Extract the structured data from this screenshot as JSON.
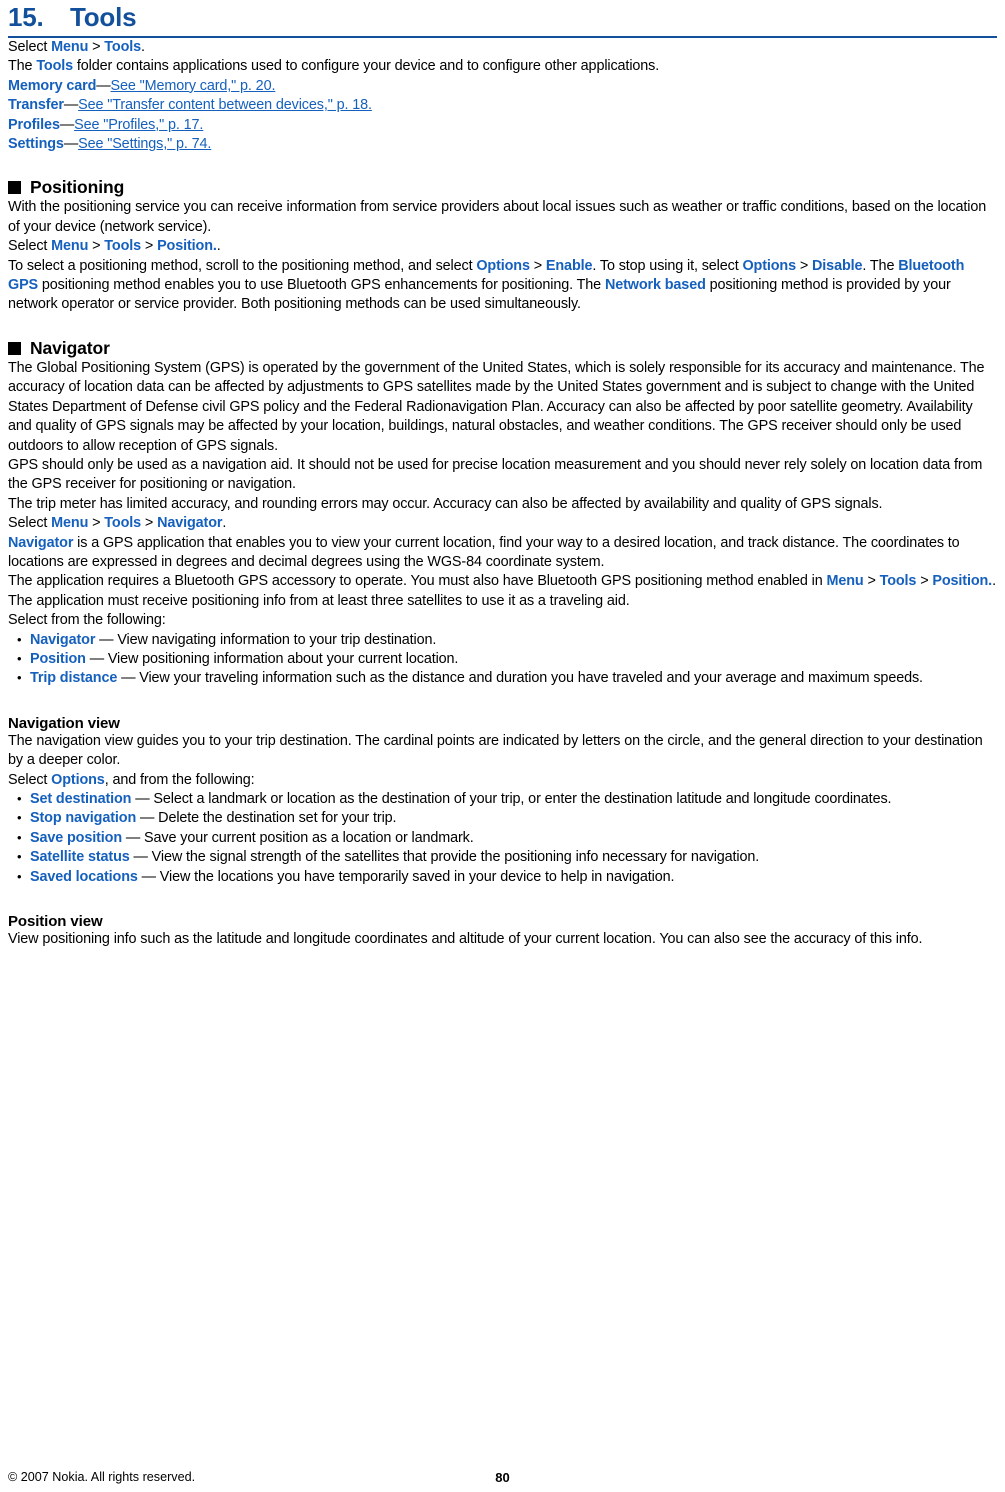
{
  "chapter": {
    "number": "15.",
    "title": "Tools"
  },
  "intro": {
    "select_prefix": "Select ",
    "select_menu": "Menu",
    "sep": " > ",
    "select_tools": "Tools",
    "select_suffix": ".",
    "folder_pre": "The ",
    "folder_tools": "Tools",
    "folder_post": " folder contains applications used to configure your device and to configure other applications.",
    "links": [
      {
        "term": "Memory card",
        "dash": "—",
        "link": "See \"Memory card,\" p. 20."
      },
      {
        "term": "Transfer",
        "dash": "—",
        "link": "See \"Transfer content between devices,\" p. 18."
      },
      {
        "term": "Profiles",
        "dash": "—",
        "link": "See \"Profiles,\" p. 17."
      },
      {
        "term": "Settings",
        "dash": "—",
        "link": "See \"Settings,\" p. 74."
      }
    ]
  },
  "positioning": {
    "heading": "Positioning",
    "p1": "With the positioning service you can receive information from service providers about local issues such as weather or traffic conditions, based on the location of your device (network service).",
    "p2_prefix": "Select ",
    "p2_menu": "Menu",
    "p2_tools": "Tools",
    "p2_position": "Position.",
    "p2_suffix": ".",
    "p3_a": "To select a positioning method, scroll to the positioning method, and select ",
    "p3_options1": "Options",
    "p3_enable": "Enable",
    "p3_b": ". To stop using it, select ",
    "p3_options2": "Options",
    "p3_disable": "Disable",
    "p3_c": ". The ",
    "p3_bt": "Bluetooth GPS",
    "p3_d": " positioning method enables you to use Bluetooth GPS enhancements for positioning. The ",
    "p3_network": "Network based",
    "p3_e": " positioning method is provided by your network operator or service provider. Both positioning methods can be used simultaneously."
  },
  "navigator": {
    "heading": "Navigator",
    "p1": "The Global Positioning System (GPS) is operated by the government of the United States, which is solely responsible for its accuracy and maintenance. The accuracy of location data can be affected by adjustments to GPS satellites made by the United States government and is subject to change with the United States Department of Defense civil GPS policy and the Federal Radionavigation Plan. Accuracy can also be affected by poor satellite geometry. Availability and quality of GPS signals may be affected by your location, buildings, natural obstacles, and weather conditions. The GPS receiver should only be used outdoors to allow reception of GPS signals.",
    "p2": "GPS should only be used as a navigation aid. It should not be used for precise location measurement and you should never rely solely on location data from the GPS receiver for positioning or navigation.",
    "p3": "The trip meter has limited accuracy, and rounding errors may occur. Accuracy can also be affected by availability and quality of GPS signals.",
    "p4_prefix": "Select ",
    "p4_menu": "Menu",
    "p4_tools": "Tools",
    "p4_navigator": "Navigator",
    "p4_suffix": ".",
    "p5_term": "Navigator",
    "p5_text": " is a GPS application that enables you to view your current location, find your way to a desired location, and track distance. The coordinates to locations are expressed in degrees and decimal degrees using the WGS-84 coordinate system.",
    "p6_a": "The application requires a Bluetooth GPS accessory to operate. You must also have Bluetooth GPS positioning method enabled in ",
    "p6_menu": "Menu",
    "p6_tools": "Tools",
    "p6_position": "Position.",
    "p6_suffix": ".",
    "p7": "The application must receive positioning info from at least three satellites to use it as a traveling aid.",
    "p8": "Select from the following:",
    "bullets": [
      {
        "term": "Navigator",
        "desc": " — View navigating information to your trip destination."
      },
      {
        "term": "Position",
        "desc": " — View positioning information about your current location."
      },
      {
        "term": "Trip distance",
        "desc": " — View your traveling information such as the distance and duration you have traveled and your average and maximum speeds."
      }
    ]
  },
  "navigation_view": {
    "heading": "Navigation view",
    "p1": "The navigation view guides you to your trip destination. The cardinal points are indicated by letters on the circle, and the general direction to your destination by a deeper color.",
    "p2_prefix": "Select ",
    "p2_options": "Options",
    "p2_suffix": ", and from the following:",
    "bullets": [
      {
        "term": "Set destination",
        "desc": " — Select a landmark or location as the destination of your trip, or enter the destination latitude and longitude coordinates."
      },
      {
        "term": "Stop navigation",
        "desc": " — Delete the destination set for your trip."
      },
      {
        "term": "Save position",
        "desc": " — Save your current position as a location or landmark."
      },
      {
        "term": "Satellite status",
        "desc": " — View the signal strength of the satellites that provide the positioning info necessary for navigation."
      },
      {
        "term": "Saved locations",
        "desc": " — View the locations you have temporarily saved in your device to help in navigation."
      }
    ]
  },
  "position_view": {
    "heading": "Position view",
    "p1": "View positioning info such as the latitude and longitude coordinates and altitude of your current location. You can also see the accuracy of this info."
  },
  "footer": {
    "copyright": "© 2007 Nokia. All rights reserved.",
    "page_number": "80"
  },
  "colors": {
    "accent_blue": "#13509c",
    "link_blue": "#1560bd",
    "text_black": "#000000"
  }
}
